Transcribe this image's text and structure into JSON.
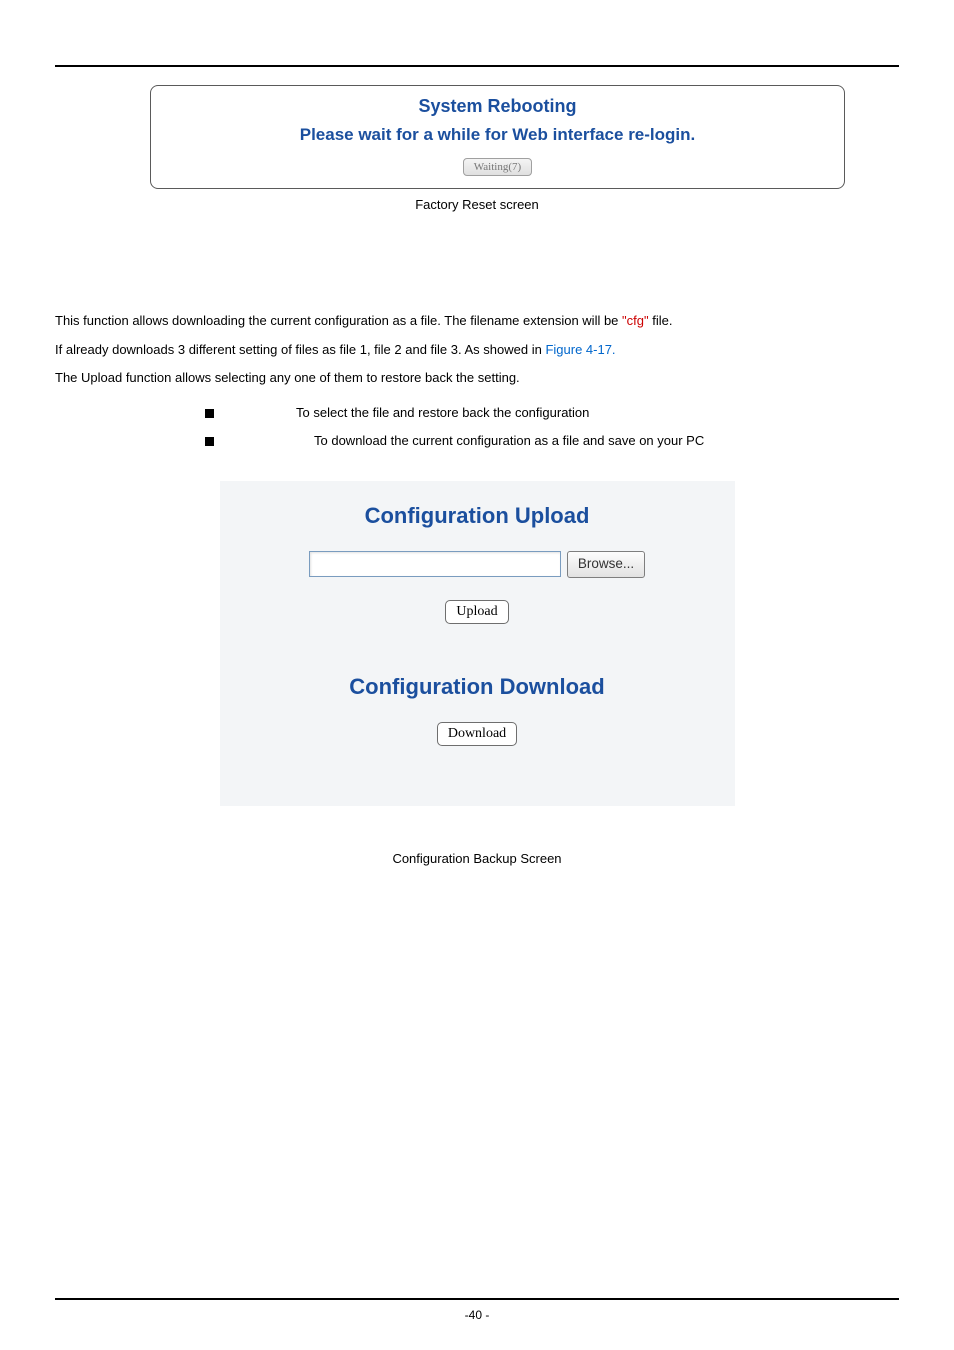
{
  "rebootCard": {
    "title": "System Rebooting",
    "subtitle": "Please wait for a while for Web interface re-login.",
    "waitingLabel": "Waiting(7)"
  },
  "caption1": "Factory Reset screen",
  "para": {
    "line1_a": "This function allows downloading the current configuration as a file. The filename extension will be ",
    "line1_red": "\"cfg\"",
    "line1_b": " file.",
    "line2_a": "If already downloads 3 different setting of files as file 1, file 2 and file 3. As showed in ",
    "line2_blue": "Figure 4-17.",
    "line3": "The Upload function allows selecting any one of them to restore back the setting."
  },
  "bullets": {
    "b1": "To select the file and restore back the configuration",
    "b2": "To download the current configuration as a file and save on your PC"
  },
  "configBox": {
    "uploadTitle": "Configuration Upload",
    "browseLabel": "Browse...",
    "uploadLabel": "Upload",
    "downloadTitle": "Configuration Download",
    "downloadLabel": "Download"
  },
  "caption2": "Configuration Backup Screen",
  "footer": {
    "page": "-40 -"
  }
}
